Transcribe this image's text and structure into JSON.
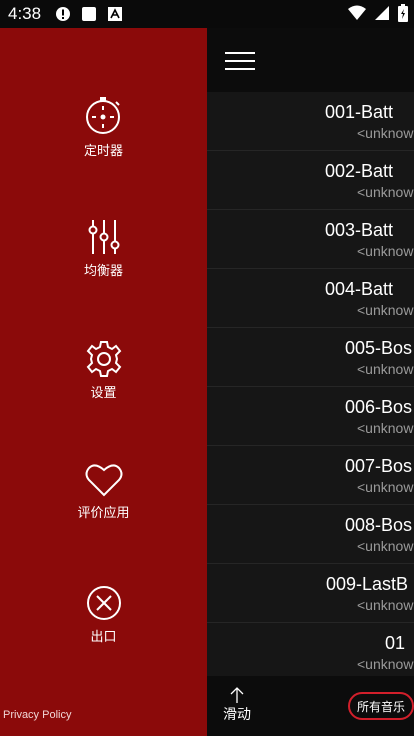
{
  "status_bar": {
    "time": "4:38",
    "icons": [
      "alert-icon",
      "square-icon",
      "a-icon"
    ],
    "right_icons": [
      "wifi-icon",
      "signal-icon",
      "battery-icon"
    ]
  },
  "drawer": {
    "items": [
      {
        "label": "定时器",
        "icon": "timer-icon"
      },
      {
        "label": "均衡器",
        "icon": "equalizer-icon"
      },
      {
        "label": "设置",
        "icon": "settings-icon"
      },
      {
        "label": "评价应用",
        "icon": "heart-icon"
      },
      {
        "label": "出口",
        "icon": "exit-icon"
      }
    ],
    "privacy_policy": "Privacy Policy"
  },
  "songs": [
    {
      "title": "001-Batt",
      "artist": "<unknow"
    },
    {
      "title": "002-Batt",
      "artist": "<unknow"
    },
    {
      "title": "003-Batt",
      "artist": "<unknow"
    },
    {
      "title": "004-Batt",
      "artist": "<unknow"
    },
    {
      "title": "005-Bos",
      "artist": "<unknow"
    },
    {
      "title": "006-Bos",
      "artist": "<unknow"
    },
    {
      "title": "007-Bos",
      "artist": "<unknow"
    },
    {
      "title": "008-Bos",
      "artist": "<unknow"
    },
    {
      "title": "009-LastB",
      "artist": "<unknow"
    },
    {
      "title": "01",
      "artist": "<unknow"
    }
  ],
  "bottom_bar": {
    "scroll_label": "滑动",
    "all_music_label": "所有音乐"
  },
  "colors": {
    "drawer_bg": "#8b0a0a",
    "accent_outline": "#d21f2b"
  }
}
